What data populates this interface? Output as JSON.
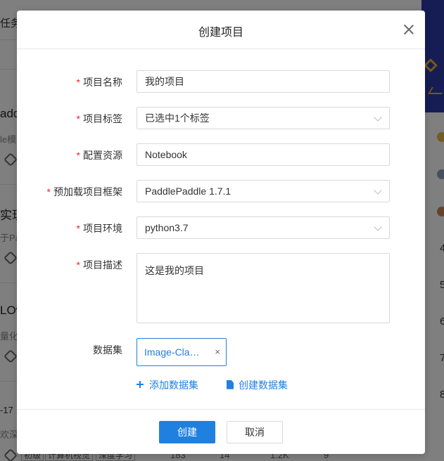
{
  "background": {
    "tab_text": "任务",
    "items": [
      {
        "title": "addl",
        "sub": "le模"
      },
      {
        "title": "实现",
        "sub": "于Pa"
      },
      {
        "title": "LOv",
        "sub": "量化"
      }
    ],
    "footer_date": "-17",
    "footer_sub": "欢深度",
    "footer_chips": [
      "初级",
      "计算机视觉",
      "深度学习"
    ],
    "footer_stats": [
      "183",
      "14",
      "1.2K",
      "9"
    ],
    "rank_numbers": [
      "4",
      "5",
      "6",
      "7",
      "8"
    ]
  },
  "modal": {
    "title": "创建项目",
    "fields": {
      "name": {
        "label": "项目名称",
        "value": "我的项目",
        "required": true
      },
      "tags": {
        "label": "项目标签",
        "value": "已选中1个标签",
        "required": true
      },
      "resource": {
        "label": "配置资源",
        "value": "Notebook",
        "required": true
      },
      "framework": {
        "label": "预加载项目框架",
        "value": "PaddlePaddle 1.7.1",
        "required": true
      },
      "env": {
        "label": "项目环境",
        "value": "python3.7",
        "required": true
      },
      "desc": {
        "label": "项目描述",
        "value": "这是我的项目",
        "required": true
      },
      "dataset": {
        "label": "数据集",
        "chip": "Image-Cla…",
        "chip_close": "×"
      }
    },
    "add_dataset": "添加数据集",
    "create_dataset": "创建数据集",
    "required_mark": "*",
    "footer": {
      "ok": "创建",
      "cancel": "取消"
    }
  },
  "colors": {
    "primary": "#2080e0",
    "required": "#f5222d",
    "banner": "#2a3aa8"
  }
}
